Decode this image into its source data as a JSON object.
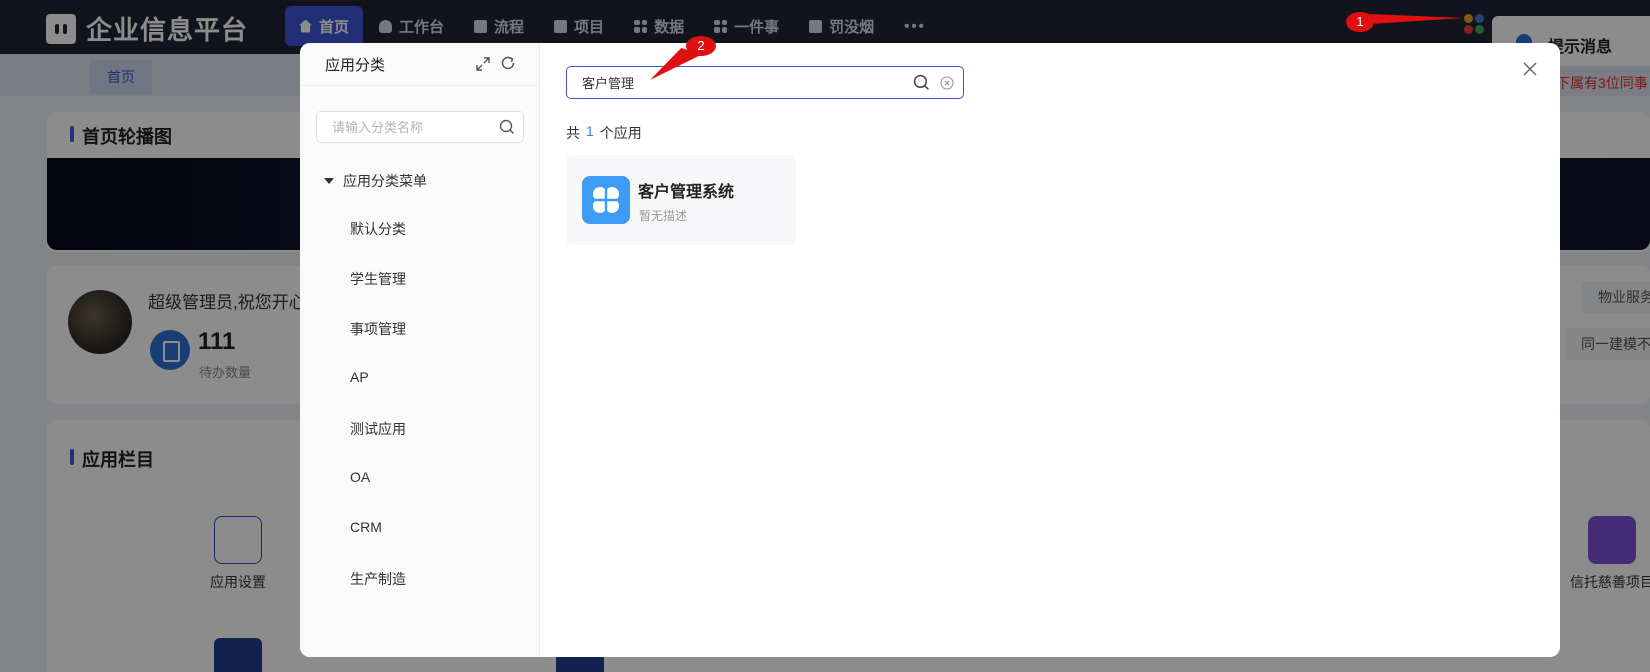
{
  "brand": {
    "title": "企业信息平台"
  },
  "nav": {
    "items": [
      {
        "label": "首页",
        "icon": "home-icon",
        "active": true
      },
      {
        "label": "工作台",
        "icon": "user-icon"
      },
      {
        "label": "流程",
        "icon": "flow-icon"
      },
      {
        "label": "项目",
        "icon": "document-icon"
      },
      {
        "label": "数据",
        "icon": "grid-icon"
      },
      {
        "label": "一件事",
        "icon": "grid-icon"
      },
      {
        "label": "罚没烟",
        "icon": "table-icon"
      },
      {
        "label": "•••",
        "icon": "more-icon"
      }
    ]
  },
  "tabs": {
    "home": "首页"
  },
  "notification": {
    "title": "提示消息",
    "text": "下属有3位同事"
  },
  "background": {
    "carousel_title": "首页轮播图",
    "welcome": "超级管理员,祝您开心",
    "todo_count": "111",
    "todo_label": "待办数量",
    "chips": [
      "物业服务",
      "同一建模不同"
    ],
    "apps_title": "应用栏目",
    "app_tiles": [
      "应用设置",
      "信托慈善项目"
    ]
  },
  "annotations": {
    "first": "1",
    "second": "2"
  },
  "modal": {
    "sidebar": {
      "title": "应用分类",
      "search_placeholder": "请输入分类名称",
      "root_label": "应用分类菜单",
      "categories": [
        "默认分类",
        "学生管理",
        "事项管理",
        "AP",
        "测试应用",
        "OA",
        "CRM",
        "生产制造"
      ]
    },
    "search": {
      "value": "客户管理"
    },
    "result": {
      "prefix": "共",
      "count": "1",
      "suffix": "个应用"
    },
    "apps": [
      {
        "name": "客户管理系统",
        "description": "暂无描述"
      }
    ]
  },
  "colors": {
    "accent": "#3e55d8",
    "topbar": "#1f2435",
    "app_icon": "#3f9cf5",
    "annotation": "#e01010"
  }
}
